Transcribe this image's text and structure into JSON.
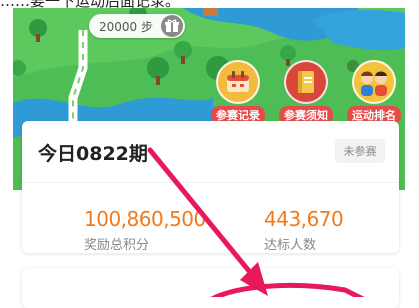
{
  "caption": "……要一下运动后面记录。",
  "banner": {
    "step_pill": "20000 步",
    "buttons": [
      {
        "label": "参赛记录",
        "icon": "calendar-bag-icon",
        "color": "#f4b93f"
      },
      {
        "label": "参赛须知",
        "icon": "book-icon",
        "color": "#d9473c"
      },
      {
        "label": "运动排名",
        "icon": "people-icon",
        "color": "#f4c33c"
      }
    ]
  },
  "period": {
    "title": "今日0822期",
    "status": "未参赛"
  },
  "stats": [
    {
      "value": "100,860,500",
      "label": "奖励总积分"
    },
    {
      "value": "443,670",
      "label": "达标人数"
    }
  ],
  "colors": {
    "accent": "#f07b1f",
    "annotation": "#e8195a",
    "grass": "#4ebd55"
  }
}
